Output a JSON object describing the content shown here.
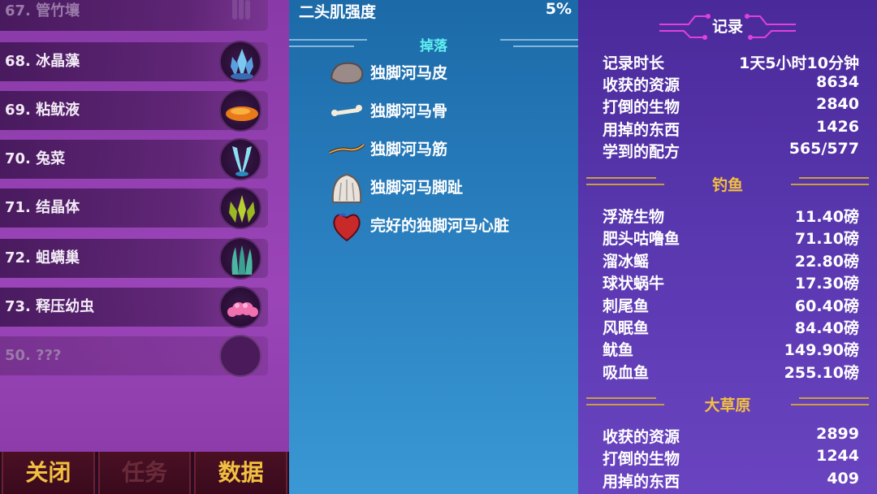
{
  "left_list": {
    "items": [
      {
        "label": "67. 管竹壤",
        "icon": "tube-coral-icon",
        "dim": true
      },
      {
        "label": "68. 冰晶藻",
        "icon": "ice-crystal-algae-icon",
        "dim": false
      },
      {
        "label": "69. 粘鱿液",
        "icon": "slime-puddle-icon",
        "dim": false
      },
      {
        "label": "70. 兔菜",
        "icon": "bunny-leaf-icon",
        "dim": false
      },
      {
        "label": "71. 结晶体",
        "icon": "crystal-cluster-icon",
        "dim": false
      },
      {
        "label": "72. 蛆螨巢",
        "icon": "mite-nest-icon",
        "dim": false
      },
      {
        "label": "73. 释压幼虫",
        "icon": "pink-larva-icon",
        "dim": false
      },
      {
        "label": "50. ???",
        "icon": "unknown-slot-icon",
        "dim": true
      }
    ]
  },
  "bottom_tabs": {
    "close": "关闭",
    "quest": "任务",
    "data": "数据"
  },
  "center": {
    "stat_label": "二头肌强度",
    "stat_value": "5%",
    "drops_title": "掉落",
    "drops": [
      {
        "label": "独脚河马皮",
        "icon": "hide-icon"
      },
      {
        "label": "独脚河马骨",
        "icon": "bone-icon"
      },
      {
        "label": "独脚河马筋",
        "icon": "sinew-icon"
      },
      {
        "label": "独脚河马脚趾",
        "icon": "toe-icon"
      },
      {
        "label": "完好的独脚河马心脏",
        "icon": "heart-icon"
      }
    ]
  },
  "right": {
    "records_title": "记录",
    "records": [
      {
        "k": "记录时长",
        "v": "1天5小时10分钟"
      },
      {
        "k": "收获的资源",
        "v": "8634"
      },
      {
        "k": "打倒的生物",
        "v": "2840"
      },
      {
        "k": "用掉的东西",
        "v": "1426"
      },
      {
        "k": "学到的配方",
        "v": "565/577"
      }
    ],
    "fishing_title": "钓鱼",
    "fishing": [
      {
        "k": "浮游生物",
        "v": "11.40磅"
      },
      {
        "k": "肥头咕噜鱼",
        "v": "71.10磅"
      },
      {
        "k": "溜冰鳐",
        "v": "22.80磅"
      },
      {
        "k": "球状蜗牛",
        "v": "17.30磅"
      },
      {
        "k": "刺尾鱼",
        "v": "60.40磅"
      },
      {
        "k": "风眠鱼",
        "v": "84.40磅"
      },
      {
        "k": "鱿鱼",
        "v": "149.90磅"
      },
      {
        "k": "吸血鱼",
        "v": "255.10磅"
      }
    ],
    "savanna_title": "大草原",
    "savanna": [
      {
        "k": "收获的资源",
        "v": "2899"
      },
      {
        "k": "打倒的生物",
        "v": "1244"
      },
      {
        "k": "用掉的东西",
        "v": "409"
      }
    ]
  },
  "colors": {
    "gold": "#f2c040",
    "cyan": "#5ef0f0",
    "records_title": "#ffffff"
  }
}
